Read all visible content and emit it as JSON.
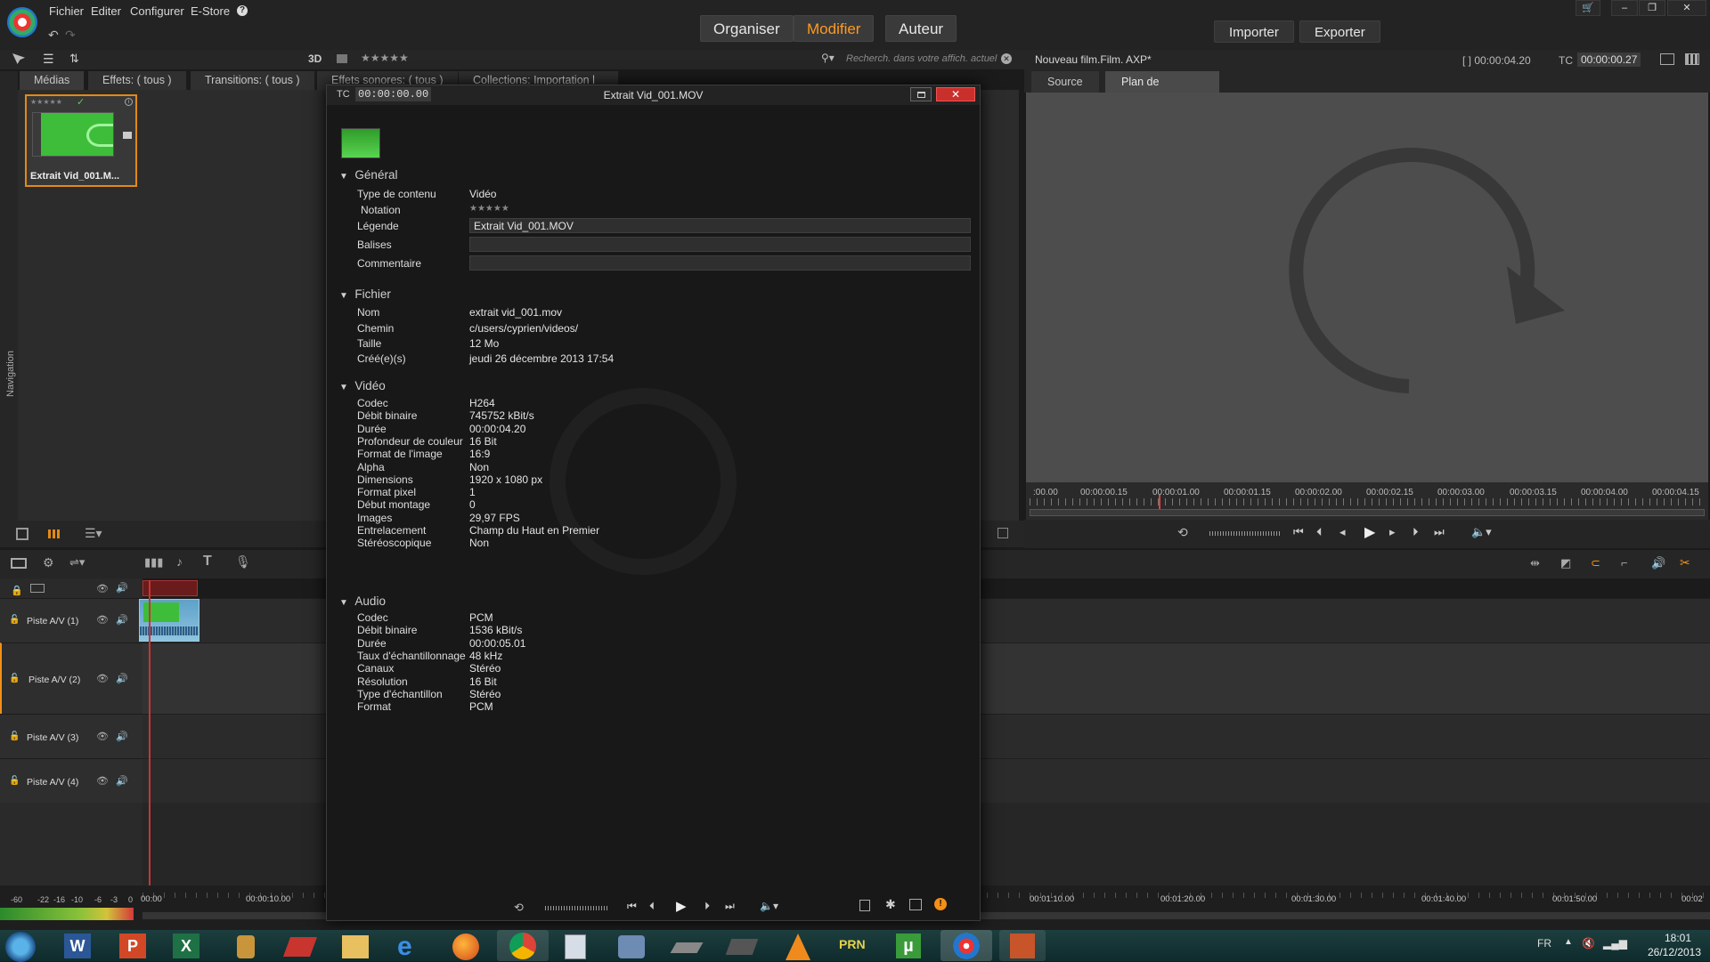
{
  "menu": {
    "items": [
      "Fichier",
      "Editer",
      "Configurer",
      "E-Store"
    ],
    "help_glyph": "?"
  },
  "modes": {
    "organiser": "Organiser",
    "modifier": "Modifier",
    "auteur": "Auteur",
    "active": "Modifier"
  },
  "actions": {
    "importer": "Importer",
    "exporter": "Exporter"
  },
  "library": {
    "toggle_3d": "3D",
    "rating_stars": "★★★★★",
    "search_placeholder": "Recherch. dans votre affich. actuel",
    "tabs": [
      "Médias",
      "Effets: ( tous )",
      "Transitions: ( tous )",
      "Effets sonores: ( tous )",
      "Collections: Importation l"
    ],
    "nav_label": "Navigation",
    "clip": {
      "label": "Extrait Vid_001.M...",
      "stars": "★★★★★",
      "check": "✓"
    }
  },
  "player": {
    "project_name": "Nouveau film.Film. AXP*",
    "duration_label": "[ ] 00:00:04.20",
    "tc_label": "TC",
    "tc_value": "00:00:00.27",
    "tabs": [
      "Source",
      "Plan de montage"
    ],
    "active_tab": "Plan de montage",
    "ruler": [
      ":00.00",
      "00:00:00.15",
      "00:00:01.00",
      "00:00:01.15",
      "00:00:02.00",
      "00:00:02.15",
      "00:00:03.00",
      "00:00:03.15",
      "00:00:04.00",
      "00:00:04.15"
    ]
  },
  "timeline": {
    "tracks": [
      "Piste A/V (1)",
      "Piste A/V (2)",
      "Piste A/V (3)",
      "Piste A/V (4)"
    ],
    "ruler": [
      "00:00",
      "00:00:10.00",
      "00:01:10.00",
      "00:01:20.00",
      "00:01:30.00",
      "00:01:40.00",
      "00:01:50.00",
      "00:02"
    ],
    "meter": [
      "-60",
      "-22",
      "-16",
      "-10",
      "-6",
      "-3",
      "0"
    ]
  },
  "dialog": {
    "tc_label": "TC",
    "tc_value": "00:00:00.00",
    "title": "Extrait Vid_001.MOV",
    "general": {
      "heading": "Général",
      "rows": [
        {
          "label": "Type de contenu",
          "value": "Vidéo"
        },
        {
          "label": "Notation",
          "value": "★★★★★"
        },
        {
          "label": "Légende",
          "value": "Extrait Vid_001.MOV"
        },
        {
          "label": "Balises",
          "value": ""
        },
        {
          "label": "Commentaire",
          "value": ""
        }
      ]
    },
    "fichier": {
      "heading": "Fichier",
      "rows": [
        {
          "label": "Nom",
          "value": "extrait vid_001.mov"
        },
        {
          "label": "Chemin",
          "value": "c/users/cyprien/videos/"
        },
        {
          "label": "Taille",
          "value": "12 Mo"
        },
        {
          "label": "Créé(e)(s)",
          "value": "jeudi 26 décembre 2013 17:54"
        }
      ]
    },
    "video": {
      "heading": "Vidéo",
      "rows": [
        {
          "label": "Codec",
          "value": "H264"
        },
        {
          "label": "Débit binaire",
          "value": "745752 kBit/s"
        },
        {
          "label": "Durée",
          "value": "00:00:04.20"
        },
        {
          "label": "Profondeur de couleur",
          "value": "16 Bit"
        },
        {
          "label": "Format de l'image",
          "value": "16:9"
        },
        {
          "label": "Alpha",
          "value": "Non"
        },
        {
          "label": "Dimensions",
          "value": "1920 x 1080 px"
        },
        {
          "label": "Format pixel",
          "value": "1"
        },
        {
          "label": "Début montage",
          "value": "0"
        },
        {
          "label": "Images",
          "value": "29,97 FPS"
        },
        {
          "label": "Entrelacement",
          "value": "Champ du Haut en Premier"
        },
        {
          "label": "Stéréoscopique",
          "value": "Non"
        }
      ]
    },
    "audio": {
      "heading": "Audio",
      "rows": [
        {
          "label": "Codec",
          "value": "PCM"
        },
        {
          "label": "Débit binaire",
          "value": "1536 kBit/s"
        },
        {
          "label": "Durée",
          "value": "00:00:05.01"
        },
        {
          "label": "Taux d'échantillonnage",
          "value": "48 kHz"
        },
        {
          "label": "Canaux",
          "value": "Stéréo"
        },
        {
          "label": "Résolution",
          "value": "16 Bit"
        },
        {
          "label": "Type d'échantillon",
          "value": "Stéréo"
        },
        {
          "label": "Format",
          "value": "PCM"
        }
      ]
    }
  },
  "taskbar": {
    "lang": "FR",
    "time": "18:01",
    "date": "26/12/2013"
  },
  "colors": {
    "accent": "#f39018",
    "window_bg": "#1b1b1b",
    "viewer_bg": "#4d4d4d"
  }
}
